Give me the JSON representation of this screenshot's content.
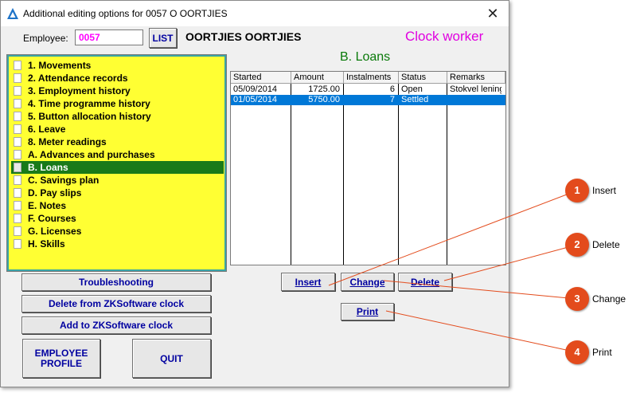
{
  "window": {
    "title": "Additional editing options for 0057 O OORTJIES",
    "close_glyph": "✕"
  },
  "employee": {
    "label": "Employee:",
    "value": "0057",
    "list_button": "LIST",
    "name": "OORTJIES OORTJIES",
    "type": "Clock worker"
  },
  "section_title": "B. Loans",
  "menu": {
    "items": [
      {
        "label": "1. Movements"
      },
      {
        "label": "2. Attendance records"
      },
      {
        "label": "3. Employment history"
      },
      {
        "label": "4. Time programme history"
      },
      {
        "label": "5. Button allocation history"
      },
      {
        "label": "6. Leave"
      },
      {
        "label": "8. Meter readings"
      },
      {
        "label": "A. Advances and purchases"
      },
      {
        "label": "B. Loans"
      },
      {
        "label": "C. Savings plan"
      },
      {
        "label": "D. Pay slips"
      },
      {
        "label": "E. Notes"
      },
      {
        "label": "F. Courses"
      },
      {
        "label": "G. Licenses"
      },
      {
        "label": "H. Skills"
      }
    ],
    "selected_index": 8
  },
  "table": {
    "columns": [
      "Started",
      "Amount",
      "Instalments",
      "Status",
      "Remarks"
    ],
    "rows": [
      [
        "05/09/2014",
        "1725.00",
        "6",
        "Open",
        "Stokvel lening"
      ],
      [
        "01/05/2014",
        "5750.00",
        "7",
        "Settled",
        ""
      ]
    ],
    "selected_row": 1
  },
  "buttons": {
    "troubleshooting": "Troubleshooting",
    "delete_from_clock": "Delete from ZKSoftware clock",
    "add_to_clock": "Add to ZKSoftware clock",
    "employee_profile": "EMPLOYEE PROFILE",
    "quit": "QUIT",
    "insert": "Insert",
    "change": "Change",
    "delete": "Delete",
    "print": "Print"
  },
  "callouts": [
    {
      "number": "1",
      "label": "Insert"
    },
    {
      "number": "2",
      "label": "Delete"
    },
    {
      "number": "3",
      "label": "Change"
    },
    {
      "number": "4",
      "label": "Print"
    }
  ],
  "colors": {
    "accent_red": "#e34b1c",
    "tree_bg": "#ffff33",
    "selected_tree": "#197a19",
    "selected_row": "#0078d7",
    "clock_worker": "#e000e0",
    "section_title": "#0a7a0a"
  }
}
